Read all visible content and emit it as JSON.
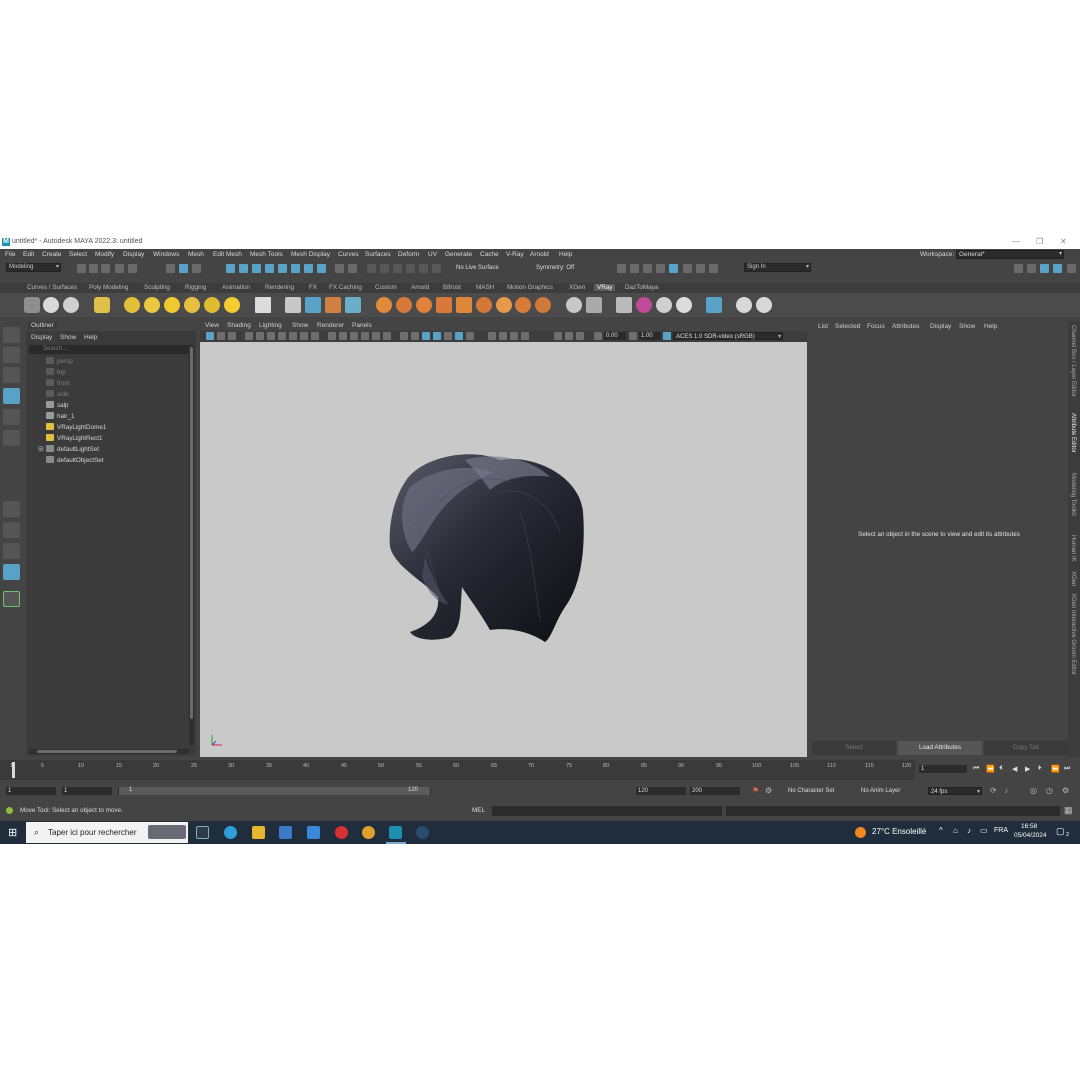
{
  "window": {
    "title": "untitled* - Autodesk MAYA 2022.3: untitled",
    "app_logo": "M"
  },
  "menus": [
    "File",
    "Edit",
    "Create",
    "Select",
    "Modify",
    "Display",
    "Windows",
    "Mesh",
    "Edit Mesh",
    "Mesh Tools",
    "Mesh Display",
    "Curves",
    "Surfaces",
    "Deform",
    "UV",
    "Generate",
    "Cache",
    "V-Ray",
    "Arnold",
    "Help"
  ],
  "workspace": {
    "label": "Workspace:",
    "value": "General*"
  },
  "statusline": {
    "mode": "Modeling",
    "live_surface": "No Live Surface",
    "symmetry": "Symmetry: Off",
    "sign_in": "Sign In"
  },
  "shelf_tabs": [
    "Curves / Surfaces",
    "Poly Modeling",
    "Sculpting",
    "Rigging",
    "Animation",
    "Rendering",
    "FX",
    "FX Caching",
    "Custom",
    "Arnold",
    "Bifrost",
    "MASH",
    "Motion Graphics",
    "XGen",
    "VRay",
    "DazToMaya"
  ],
  "shelf_active": "VRay",
  "outliner": {
    "title": "Outliner",
    "menu": [
      "Display",
      "Show",
      "Help"
    ],
    "search_placeholder": "Search...",
    "items": [
      {
        "label": "persp",
        "dim": true
      },
      {
        "label": "top",
        "dim": true
      },
      {
        "label": "front",
        "dim": true
      },
      {
        "label": "side",
        "dim": true
      },
      {
        "label": "salp",
        "dim": false
      },
      {
        "label": "hair_1",
        "dim": false
      },
      {
        "label": "VRayLightDome1",
        "dim": false
      },
      {
        "label": "VRayLightRect1",
        "dim": false
      },
      {
        "label": "defaultLightSet",
        "dim": false
      },
      {
        "label": "defaultObjectSet",
        "dim": false
      }
    ]
  },
  "viewport": {
    "menu": [
      "View",
      "Shading",
      "Lighting",
      "Show",
      "Renderer",
      "Panels"
    ],
    "exposure": "0.00",
    "gamma": "1.00",
    "color_space": "ACES 1.0 SDR-video (sRGB)"
  },
  "attribute_editor": {
    "menu": [
      "List",
      "Selected",
      "Focus",
      "Attributes",
      "Display",
      "Show",
      "Help"
    ],
    "message": "Select an object in the scene to view and edit its attributes",
    "buttons": [
      "Select",
      "Load Attributes",
      "Copy Tab"
    ]
  },
  "side_tabs": [
    "Channel Box / Layer Editor",
    "Attribute Editor",
    "Modeling Toolkit",
    "Human IK",
    "XGen",
    "XGen Interactive Groom Editor"
  ],
  "timeline": {
    "ticks": [
      "1",
      "5",
      "10",
      "15",
      "20",
      "25",
      "30",
      "35",
      "40",
      "45",
      "50",
      "55",
      "60",
      "65",
      "70",
      "75",
      "80",
      "85",
      "90",
      "95",
      "100",
      "105",
      "110",
      "115",
      "120"
    ],
    "current_frame": "1"
  },
  "range": {
    "start": "1",
    "playback_start": "1",
    "slider_start": "1",
    "slider_end": "120",
    "playback_end": "120",
    "end": "200",
    "character_set": "No Character Set",
    "anim_layer": "No Anim Layer",
    "fps": "24 fps"
  },
  "helpline": {
    "text": "Move Tool: Select an object to move.",
    "command_lang": "MEL"
  },
  "taskbar": {
    "search_placeholder": "Taper ici pour rechercher",
    "weather": "27°C  Ensoleillé",
    "language": "FRA",
    "time": "16:58",
    "date": "05/04/2024",
    "notifications": "2"
  },
  "colors": {
    "accent": "#5aa3c8",
    "viewport_bg": "#c9c9c9",
    "panel": "#444444",
    "taskbar": "#1f2d3d"
  }
}
